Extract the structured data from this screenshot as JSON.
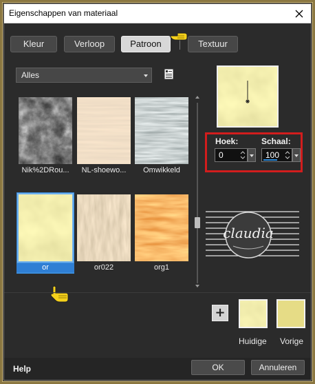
{
  "window": {
    "title": "Eigenschappen van materiaal"
  },
  "tabs": [
    {
      "label": "Kleur",
      "active": false
    },
    {
      "label": "Verloop",
      "active": false
    },
    {
      "label": "Patroon",
      "active": true
    },
    {
      "label": "Textuur",
      "active": false
    }
  ],
  "category": {
    "selected": "Alles"
  },
  "patterns": [
    {
      "name": "Nik%2DRou...",
      "selected": false
    },
    {
      "name": "NL-shoewo...",
      "selected": false
    },
    {
      "name": "Omwikkeld",
      "selected": false
    },
    {
      "name": "or",
      "selected": true
    },
    {
      "name": "or022",
      "selected": false
    },
    {
      "name": "org1",
      "selected": false
    }
  ],
  "angle": {
    "label": "Hoek:",
    "value": "0"
  },
  "scale": {
    "label": "Schaal:",
    "value": "100"
  },
  "swatches": {
    "current_label": "Huidige",
    "previous_label": "Vorige"
  },
  "footer": {
    "help_label": "Help",
    "ok_label": "OK",
    "cancel_label": "Annuleren"
  },
  "colors": {
    "accent_selection": "#3b8ddb",
    "highlight_box": "#d21d1d",
    "pattern_yellow": "#e0d77a"
  }
}
